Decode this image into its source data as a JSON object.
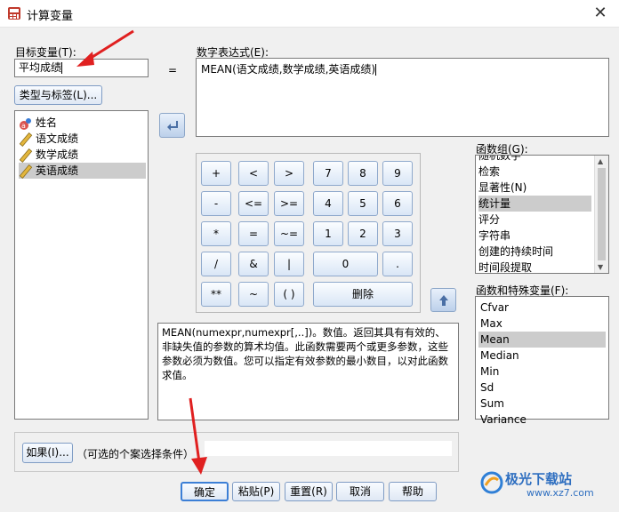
{
  "window": {
    "title": "计算变量",
    "close_glyph": "✕"
  },
  "target": {
    "label": "目标变量(T):",
    "value": "平均成绩",
    "type_button": "类型与标签(L)..."
  },
  "equals_sign": "=",
  "expression": {
    "label": "数字表达式(E):",
    "value": "MEAN(语文成绩,数学成绩,英语成绩)"
  },
  "variables": [
    {
      "label": "姓名",
      "icon": "string-variable-icon"
    },
    {
      "label": "语文成绩",
      "icon": "scale-variable-icon"
    },
    {
      "label": "数学成绩",
      "icon": "scale-variable-icon"
    },
    {
      "label": "英语成绩",
      "icon": "scale-variable-icon",
      "selected": true
    }
  ],
  "keypad": {
    "row1": [
      "+",
      "<",
      ">",
      "7",
      "8",
      "9"
    ],
    "row2": [
      "-",
      "<=",
      ">=",
      "4",
      "5",
      "6"
    ],
    "row3": [
      "*",
      "=",
      "~=",
      "1",
      "2",
      "3"
    ],
    "row4": [
      "/",
      "&",
      "|",
      "0",
      "."
    ],
    "row5": [
      "**",
      "~",
      "( )",
      "删除"
    ]
  },
  "function_group": {
    "label": "函数组(G):",
    "items": [
      "随机数字",
      "检索",
      "显著性(N)",
      "统计量",
      "评分",
      "字符串",
      "创建的持续时间",
      "时间段提取"
    ],
    "selected": "统计量"
  },
  "functions": {
    "label": "函数和特殊变量(F):",
    "items": [
      "Cfvar",
      "Max",
      "Mean",
      "Median",
      "Min",
      "Sd",
      "Sum",
      "Variance"
    ],
    "selected": "Mean"
  },
  "description": "MEAN(numexpr,numexpr[,..])。数值。返回其具有有效的、非缺失值的参数的算术均值。此函数需要两个或更多参数，这些参数必须为数值。您可以指定有效参数的最小数目，以对此函数求值。",
  "condition": {
    "button": "如果(I)...",
    "text": "（可选的个案选择条件）"
  },
  "footer": {
    "ok": "确定",
    "paste": "粘贴(P)",
    "reset": "重置(R)",
    "cancel": "取消",
    "help": "帮助"
  },
  "watermark": {
    "text": "极光下载站",
    "url": "www.xz7.com"
  },
  "colors": {
    "selection": "#cccccc",
    "button_border": "#7f9cc4",
    "annotation_arrow": "#e02020"
  }
}
